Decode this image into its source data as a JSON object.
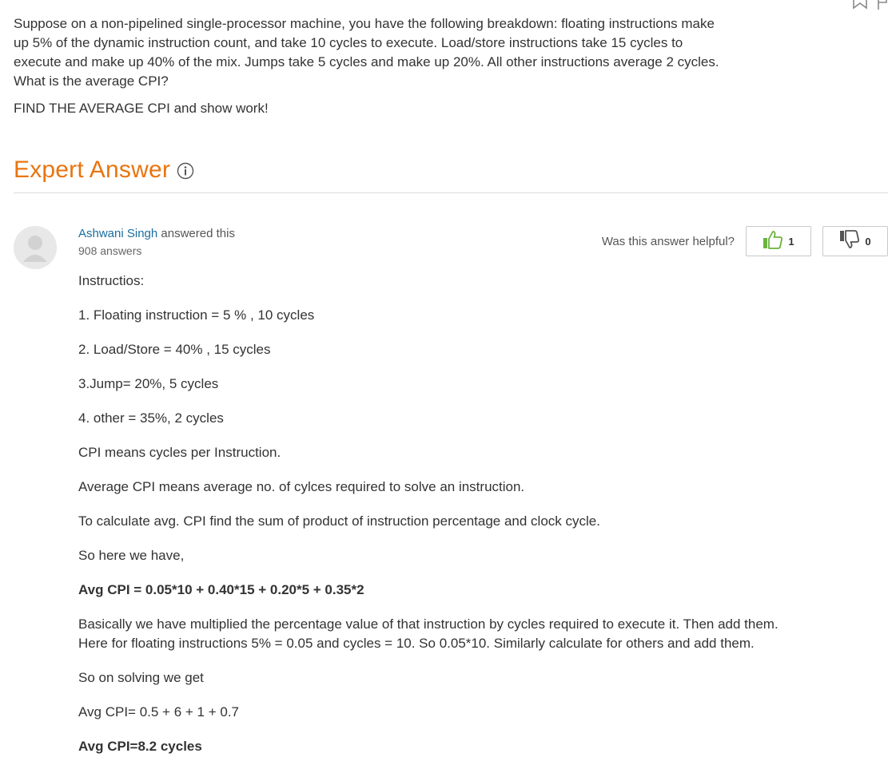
{
  "question": {
    "text": "Suppose on a non-pipelined single-processor machine, you have the following breakdown: floating instructions make up 5% of the dynamic instruction count, and take 10 cycles to execute. Load/store instructions take 15 cycles to execute and make up 40% of the mix. Jumps take 5 cycles and make up 20%. All other instructions average 2 cycles. What is the average CPI?",
    "instruction": "FIND THE AVERAGE CPI and show work!"
  },
  "expert_answer": {
    "title": "Expert Answer"
  },
  "answerer": {
    "name": "Ashwani Singh",
    "action": " answered this",
    "answers_count": "908 answers"
  },
  "helpful": {
    "label": "Was this answer helpful?",
    "thumbs_up_count": "1",
    "thumbs_down_count": "0"
  },
  "answer": {
    "paragraphs": [
      {
        "text": "Instructios:",
        "bold": false
      },
      {
        "text": "1. Floating instruction = 5 % , 10 cycles",
        "bold": false
      },
      {
        "text": "2. Load/Store = 40% , 15 cycles",
        "bold": false
      },
      {
        "text": "3.Jump= 20%, 5 cycles",
        "bold": false
      },
      {
        "text": "4. other = 35%, 2 cycles",
        "bold": false
      },
      {
        "text": "CPI means cycles per Instruction.",
        "bold": false
      },
      {
        "text": "Average CPI means average no. of cylces required to solve an instruction.",
        "bold": false
      },
      {
        "text": "To calculate avg. CPI find the sum of product of instruction percentage and clock cycle.",
        "bold": false
      },
      {
        "text": "So here we have,",
        "bold": false
      },
      {
        "text": "Avg CPI = 0.05*10 + 0.40*15 + 0.20*5 + 0.35*2",
        "bold": true
      },
      {
        "text": "Basically we have multiplied the percentage value of that instruction by cycles required to execute it. Then add them. Here for floating instructions 5% = 0.05 and cycles = 10. So 0.05*10. Similarly calculate for others and add them.",
        "bold": false
      },
      {
        "text": "So on solving we get",
        "bold": false
      },
      {
        "text": "Avg CPI= 0.5 + 6 + 1 + 0.7",
        "bold": false
      },
      {
        "text": "Avg CPI=8.2 cycles",
        "bold": true
      }
    ]
  },
  "icons": {
    "bookmark": "bookmark-icon",
    "flag": "flag-icon",
    "info": "info-icon",
    "thumbs_up": "thumbs-up-icon",
    "thumbs_down": "thumbs-down-icon",
    "avatar": "user-avatar-icon"
  },
  "colors": {
    "accent_orange": "#e87511",
    "link_blue": "#1a6ea0",
    "thumbs_up_green": "#6cb33f",
    "thumbs_down_gray": "#555555"
  }
}
